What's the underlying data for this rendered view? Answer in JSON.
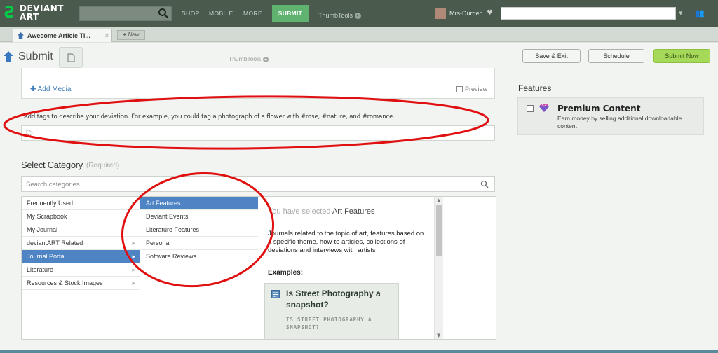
{
  "topbar": {
    "logo_line1": "DEVIANT",
    "logo_line2": "ART",
    "logo_mark": "Ƨ",
    "nav": [
      "SHOP",
      "MOBILE",
      "MORE"
    ],
    "submit_label": "SUBMIT",
    "thumbtools_label": "ThumbTools",
    "username": "Mrs-Durden",
    "search_icon": "search-icon",
    "heart_icon": "heart-icon"
  },
  "tabbar": {
    "tab_label": "Awesome Article Ti...",
    "tab_close": "×",
    "new_tab_label": "New",
    "new_tab_plus": "+"
  },
  "header": {
    "page_title": "Submit",
    "thumbtools_label": "ThumbTools",
    "buttons": {
      "save_exit": "Save & Exit",
      "schedule": "Schedule",
      "submit_now": "Submit Now"
    }
  },
  "editor": {
    "add_media": "Add Media",
    "preview": "Preview",
    "tag_help": "Add tags to describe your deviation. For example, you could tag a photograph of a flower with #rose, #nature, and #romance."
  },
  "features": {
    "title": "Features",
    "premium_name": "Premium Content",
    "premium_desc": "Earn money by selling additional downloadable content"
  },
  "category": {
    "title": "Select Category",
    "required": "(Required)",
    "search_placeholder": "Search categories",
    "col1": [
      {
        "label": "Frequently Used",
        "has_arrow": true,
        "selected": false
      },
      {
        "label": "My Scrapbook",
        "has_arrow": false,
        "selected": false
      },
      {
        "label": "My Journal",
        "has_arrow": false,
        "selected": false
      },
      {
        "label": "deviantART Related",
        "has_arrow": true,
        "selected": false
      },
      {
        "label": "Journal Portal",
        "has_arrow": true,
        "selected": true
      },
      {
        "label": "Literature",
        "has_arrow": true,
        "selected": false
      },
      {
        "label": "Resources & Stock Images",
        "has_arrow": true,
        "selected": false
      }
    ],
    "col2": [
      {
        "label": "Art Features",
        "selected": true
      },
      {
        "label": "Deviant Events",
        "selected": false
      },
      {
        "label": "Literature Features",
        "selected": false
      },
      {
        "label": "Personal",
        "selected": false
      },
      {
        "label": "Software Reviews",
        "selected": false
      }
    ],
    "detail": {
      "selected_prefix": "You have selected",
      "selected_name": "Art Features",
      "description": "Journals related to the topic of art, features based on a specific theme, how-to articles, collections of deviations and interviews with artists",
      "examples_label": "Examples:",
      "example_title": "Is Street Photography a snapshot?",
      "example_subtitle": "IS STREET PHOTOGRAPHY A SNAPSHOT?"
    }
  },
  "colors": {
    "topbar": "#4a5a4d",
    "submit_green": "#5fb26f",
    "selected_blue": "#4f84c4",
    "submit_now_green": "#a6d85a",
    "annotation_red": "#e01010"
  }
}
